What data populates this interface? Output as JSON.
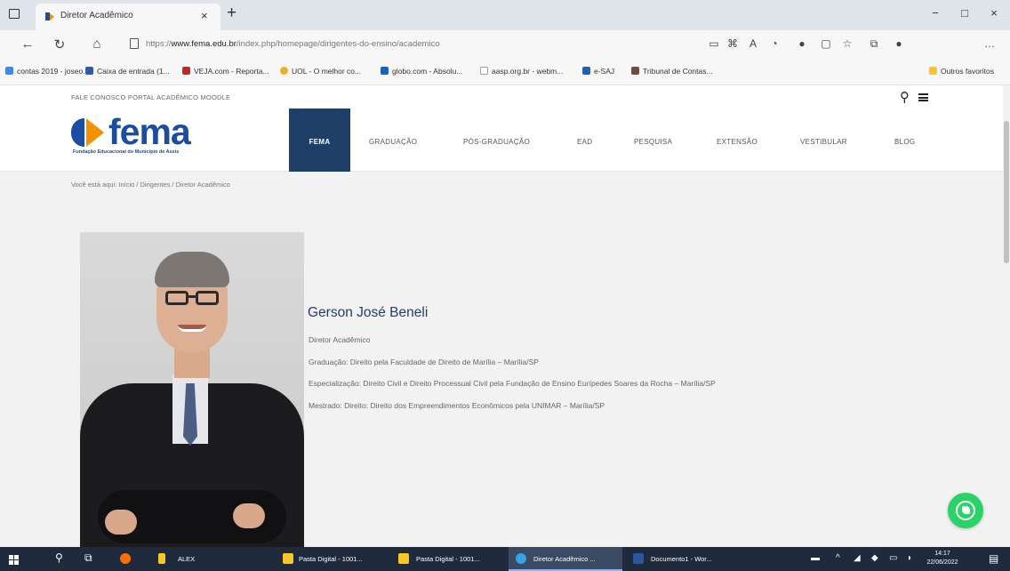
{
  "browser": {
    "tab_title": "Diretor Acadêmico",
    "tab_close": "×",
    "new_tab": "+",
    "url_prefix": "https://",
    "url_domain": "www.fema.edu.br",
    "url_path": "/index.php/homepage/dirigentes-do-ensino/academico",
    "window_controls": [
      "−",
      "□",
      "×"
    ],
    "bookmarks": [
      {
        "label": "contas 2019 - joseo...",
        "color": "#4285f4"
      },
      {
        "label": "Caixa de entrada (1...",
        "color": "#2e5aa8"
      },
      {
        "label": "VEJA.com - Reporta...",
        "color": "#c62828"
      },
      {
        "label": "UOL - O melhor co...",
        "color": "#f9a825"
      },
      {
        "label": "globo.com - Absolu...",
        "color": "#1565c0"
      },
      {
        "label": "aasp.org.br - webm...",
        "color": "#90a4ae"
      },
      {
        "label": "e-SAJ",
        "color": "#1565c0"
      },
      {
        "label": "Tribunal de Contas...",
        "color": "#6d4c41"
      },
      {
        "label": "Outros favoritos",
        "color": "#f9c623"
      }
    ]
  },
  "site": {
    "top_links": "FALE CONOSCO  PORTAL ACADÊMICO  MOODLE",
    "logo_text": "fema",
    "logo_subtitle": "Fundação Educacional do Município de Assis",
    "nav": [
      "FEMA",
      "GRADUAÇÃO",
      "PÓS-GRADUAÇÃO",
      "EAD",
      "PESQUISA",
      "EXTENSÃO",
      "VESTIBULAR",
      "BLOG"
    ],
    "breadcrumb": "Você está aqui:  Início  /  Dirigentes  /  Diretor Acadêmico",
    "brand_blue": "#1b4da0",
    "brand_orange": "#f39200",
    "nav_active_bg": "#1e3f66"
  },
  "profile": {
    "name": "Gerson José Beneli",
    "role": "Diretor Acadêmico",
    "graduacao": "Graduação: Direito pela Faculdade de Direito de Marília – Marília/SP",
    "especializacao": "Especialização: Direito Civil e Direito Processual Civil pela Fundação de Ensino Eurípedes Soares da Rocha – Marília/SP",
    "mestrado": "Mestrado: Direito: Direito dos Empreendimentos Econômicos pela UNIMAR – Marília/SP"
  },
  "taskbar": {
    "search_label": "ALEX",
    "apps": [
      {
        "label": "Pasta Digital - 1001...",
        "active": false
      },
      {
        "label": "Pasta Digital - 1001...",
        "active": false
      },
      {
        "label": "Diretor Acadêmico ...",
        "active": true
      },
      {
        "label": "Documento1 - Wor...",
        "active": false
      }
    ],
    "time": "14:17",
    "date": "22/06/2022"
  }
}
